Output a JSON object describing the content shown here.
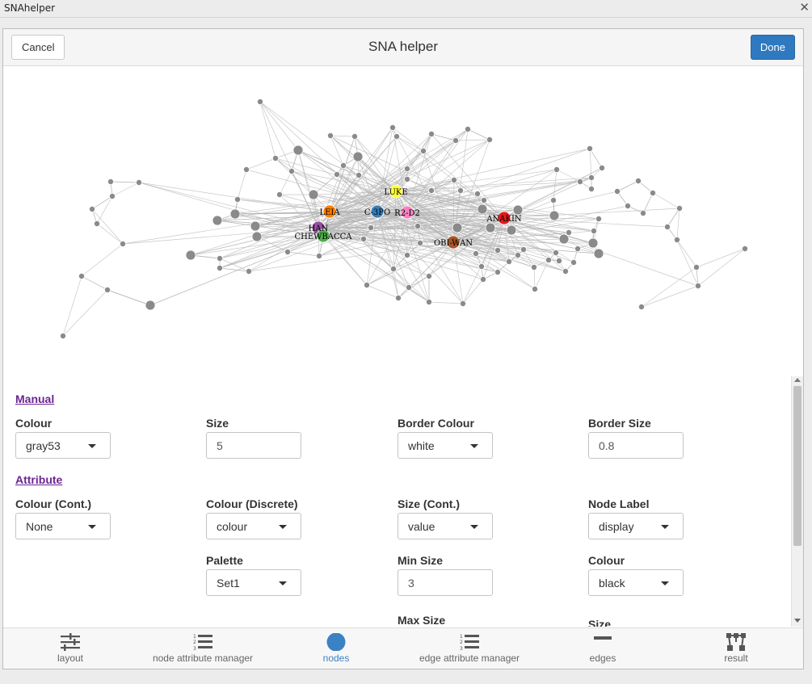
{
  "window": {
    "title": "SNAhelper",
    "close_glyph": "✕"
  },
  "header": {
    "cancel_label": "Cancel",
    "title": "SNA helper",
    "done_label": "Done"
  },
  "graph": {
    "node_colour": "#8a8a8a",
    "labels": [
      "LUKE",
      "LEIA",
      "C-3PO",
      "R2-D2",
      "ANAKIN",
      "HAN",
      "CHEWBACCA",
      "OBI-WAN"
    ],
    "label_colours": {
      "LUKE": "#ffff33",
      "LEIA": "#ff7f00",
      "C-3PO": "#377eb8",
      "R2-D2": "#f781bf",
      "ANAKIN": "#e41a1c",
      "HAN": "#984ea3",
      "CHEWBACCA": "#4daf4a",
      "OBI-WAN": "#a65628"
    }
  },
  "manual": {
    "heading": "Manual",
    "colour": {
      "label": "Colour",
      "value": "gray53"
    },
    "size": {
      "label": "Size",
      "value": "5"
    },
    "border_colour": {
      "label": "Border Colour",
      "value": "white"
    },
    "border_size": {
      "label": "Border Size",
      "value": "0.8"
    }
  },
  "attribute": {
    "heading": "Attribute",
    "colour_cont": {
      "label": "Colour (Cont.)",
      "value": "None"
    },
    "colour_discrete": {
      "label": "Colour (Discrete)",
      "value": "colour"
    },
    "size_cont": {
      "label": "Size (Cont.)",
      "value": "value"
    },
    "node_label": {
      "label": "Node Label",
      "value": "display"
    },
    "palette": {
      "label": "Palette",
      "value": "Set1"
    },
    "min_size": {
      "label": "Min Size",
      "value": "3"
    },
    "label_colour": {
      "label": "Colour",
      "value": "black"
    },
    "max_size": {
      "label": "Max Size"
    },
    "label_size": {
      "label": "Size"
    }
  },
  "tabs": [
    {
      "label": "layout",
      "icon": "sliders-icon",
      "active": false
    },
    {
      "label": "node attribute manager",
      "icon": "numbered-list-icon",
      "active": false
    },
    {
      "label": "nodes",
      "icon": "circle-icon",
      "active": true
    },
    {
      "label": "edge attribute manager",
      "icon": "numbered-list-icon",
      "active": false
    },
    {
      "label": "edges",
      "icon": "minus-icon",
      "active": false
    },
    {
      "label": "result",
      "icon": "network-icon",
      "active": false
    }
  ],
  "colors": {
    "accent": "#2f79c0",
    "section": "#6b2494"
  }
}
